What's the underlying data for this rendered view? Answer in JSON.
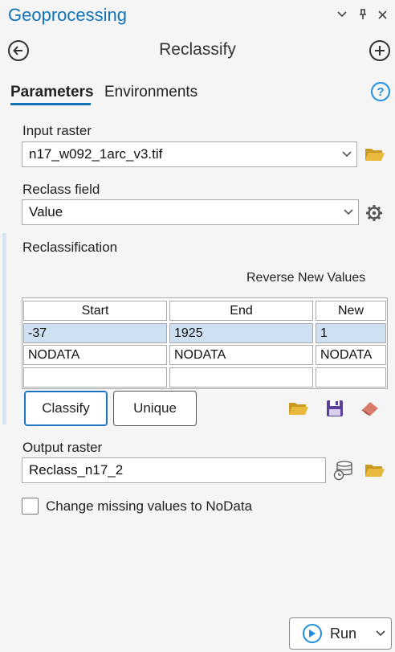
{
  "pane": {
    "title": "Geoprocessing"
  },
  "tool": {
    "title": "Reclassify"
  },
  "tabs": [
    {
      "label": "Parameters",
      "active": true
    },
    {
      "label": "Environments",
      "active": false
    }
  ],
  "input_raster": {
    "label": "Input raster",
    "value": "n17_w092_1arc_v3.tif"
  },
  "reclass_field": {
    "label": "Reclass field",
    "value": "Value"
  },
  "reclassification": {
    "label": "Reclassification",
    "reverse_label": "Reverse New Values",
    "columns": [
      "Start",
      "End",
      "New"
    ],
    "rows": [
      [
        "-37",
        "1925",
        "1"
      ],
      [
        "NODATA",
        "NODATA",
        "NODATA"
      ],
      [
        "",
        "",
        ""
      ]
    ],
    "classify_label": "Classify",
    "unique_label": "Unique"
  },
  "output_raster": {
    "label": "Output raster",
    "value": "Reclass_n17_2"
  },
  "missing_values": {
    "label": "Change missing values to NoData",
    "checked": false
  },
  "run": {
    "label": "Run"
  },
  "colors": {
    "accent": "#1272b6",
    "folder": "#e8b93c",
    "save": "#5b3d9a",
    "eraser": "#d97a6c"
  }
}
